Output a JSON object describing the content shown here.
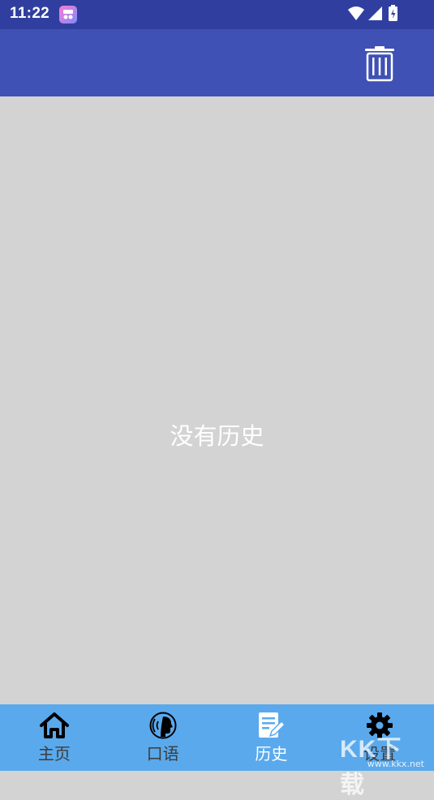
{
  "status_bar": {
    "time": "11:22",
    "icons": [
      "app-notification-icon",
      "wifi-icon",
      "signal-icon",
      "battery-icon"
    ]
  },
  "toolbar": {
    "delete_icon": "trash-icon"
  },
  "main": {
    "empty_message": "没有历史"
  },
  "bottom_nav": {
    "items": [
      {
        "label": "主页",
        "icon": "home-icon",
        "active": false
      },
      {
        "label": "口语",
        "icon": "speaking-icon",
        "active": false
      },
      {
        "label": "历史",
        "icon": "history-notes-icon",
        "active": true
      },
      {
        "label": "设置",
        "icon": "gear-icon",
        "active": false
      }
    ]
  },
  "watermark": {
    "letters": "KK下载",
    "url": "www.kkx.net"
  },
  "colors": {
    "status_bar": "#303f9f",
    "app_bar": "#3f51b5",
    "content_bg": "#d3d3d3",
    "bottom_nav": "#5aa9ec",
    "active_label": "#ffffff",
    "inactive_label": "#3c3c3c"
  }
}
